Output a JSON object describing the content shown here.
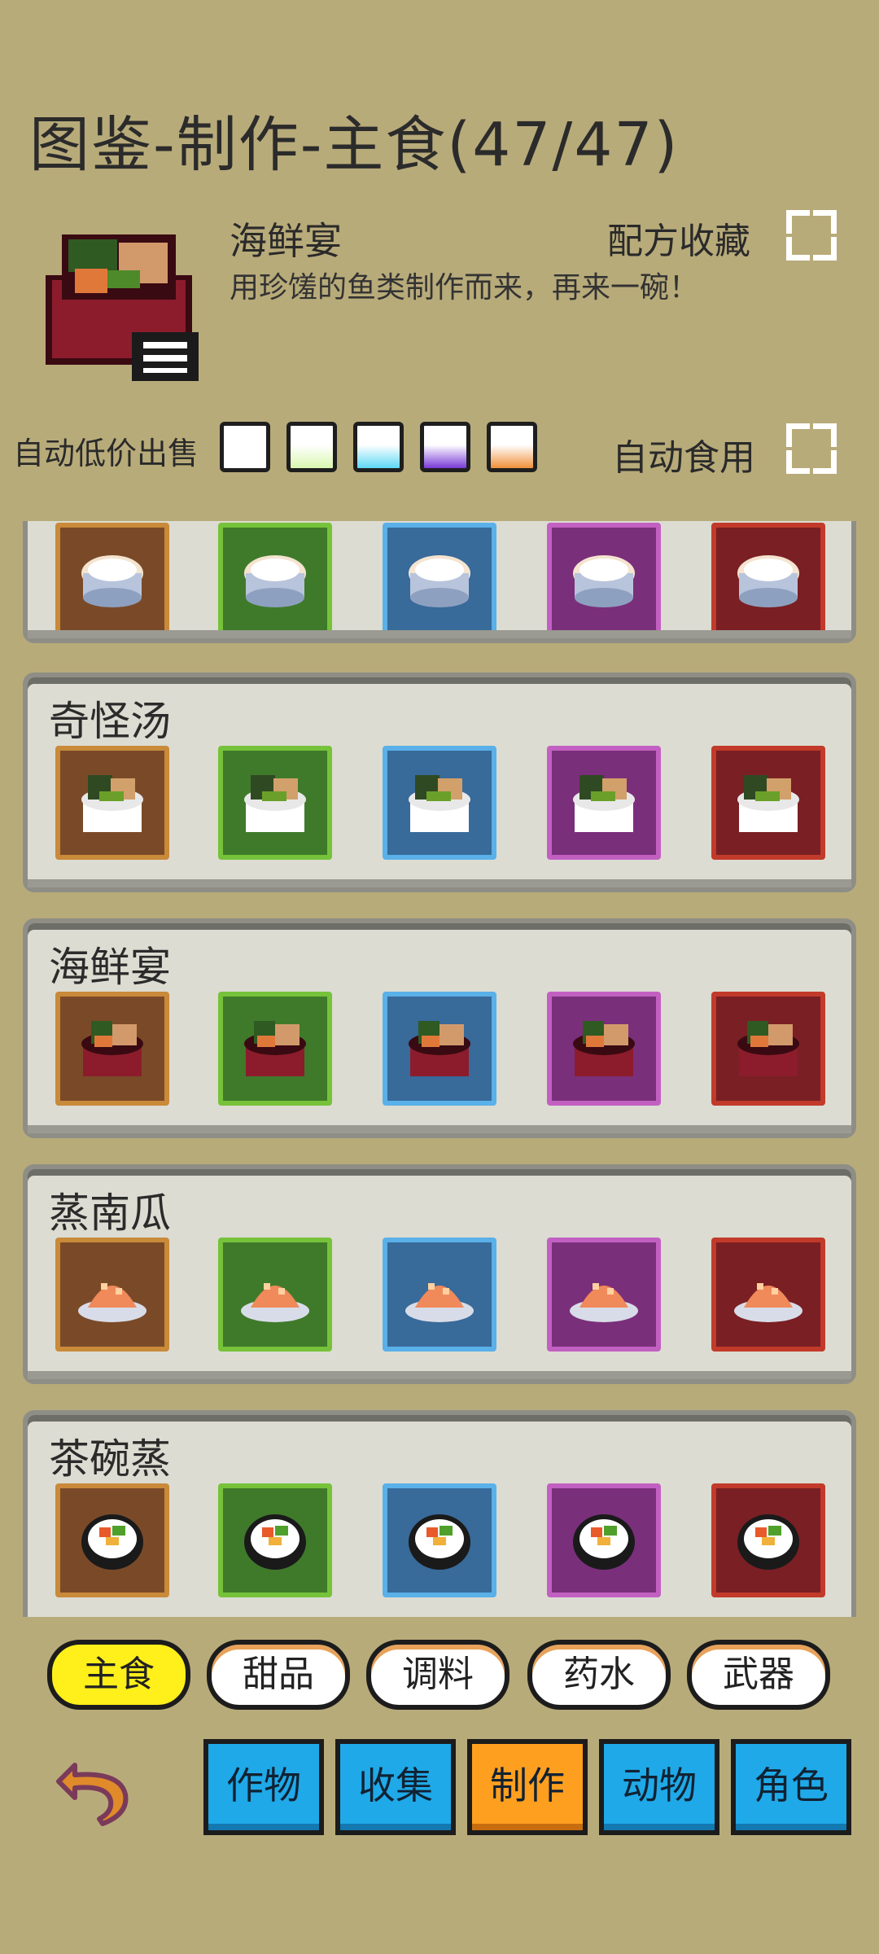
{
  "title": "图鉴-制作-主食(47/47)",
  "featured": {
    "icon": "seafood-feast-bowl-icon",
    "name": "海鲜宴",
    "description": "用珍馐的鱼类制作而来，再来一碗！",
    "favorite_label": "配方收藏"
  },
  "settings": {
    "auto_sell_label": "自动低价出售",
    "auto_eat_label": "自动食用",
    "swatches": [
      "#ffffff",
      "#d9f7b0",
      "#5fd8f5",
      "#7a3ad8",
      "#f0903a"
    ]
  },
  "frame_colors": {
    "brown": {
      "fill": "#7a4a28",
      "border": "#c98a3a"
    },
    "green": {
      "fill": "#3f7a2a",
      "border": "#76c23a"
    },
    "blue": {
      "fill": "#386a9a",
      "border": "#5ab0e8"
    },
    "purple": {
      "fill": "#7a2f7a",
      "border": "#c260c2"
    },
    "red": {
      "fill": "#7a1f24",
      "border": "#c23a2a"
    }
  },
  "recipes": [
    {
      "name": "",
      "dish": "rice-bowl-icon"
    },
    {
      "name": "奇怪汤",
      "dish": "strange-soup-icon"
    },
    {
      "name": "海鲜宴",
      "dish": "seafood-feast-icon"
    },
    {
      "name": "蒸南瓜",
      "dish": "steamed-pumpkin-icon"
    },
    {
      "name": "茶碗蒸",
      "dish": "sushi-roll-icon"
    }
  ],
  "category_tabs": [
    "主食",
    "甜品",
    "调料",
    "药水",
    "武器"
  ],
  "category_active": "主食",
  "nav_tabs": [
    "作物",
    "收集",
    "制作",
    "动物",
    "角色"
  ],
  "nav_active": "制作"
}
